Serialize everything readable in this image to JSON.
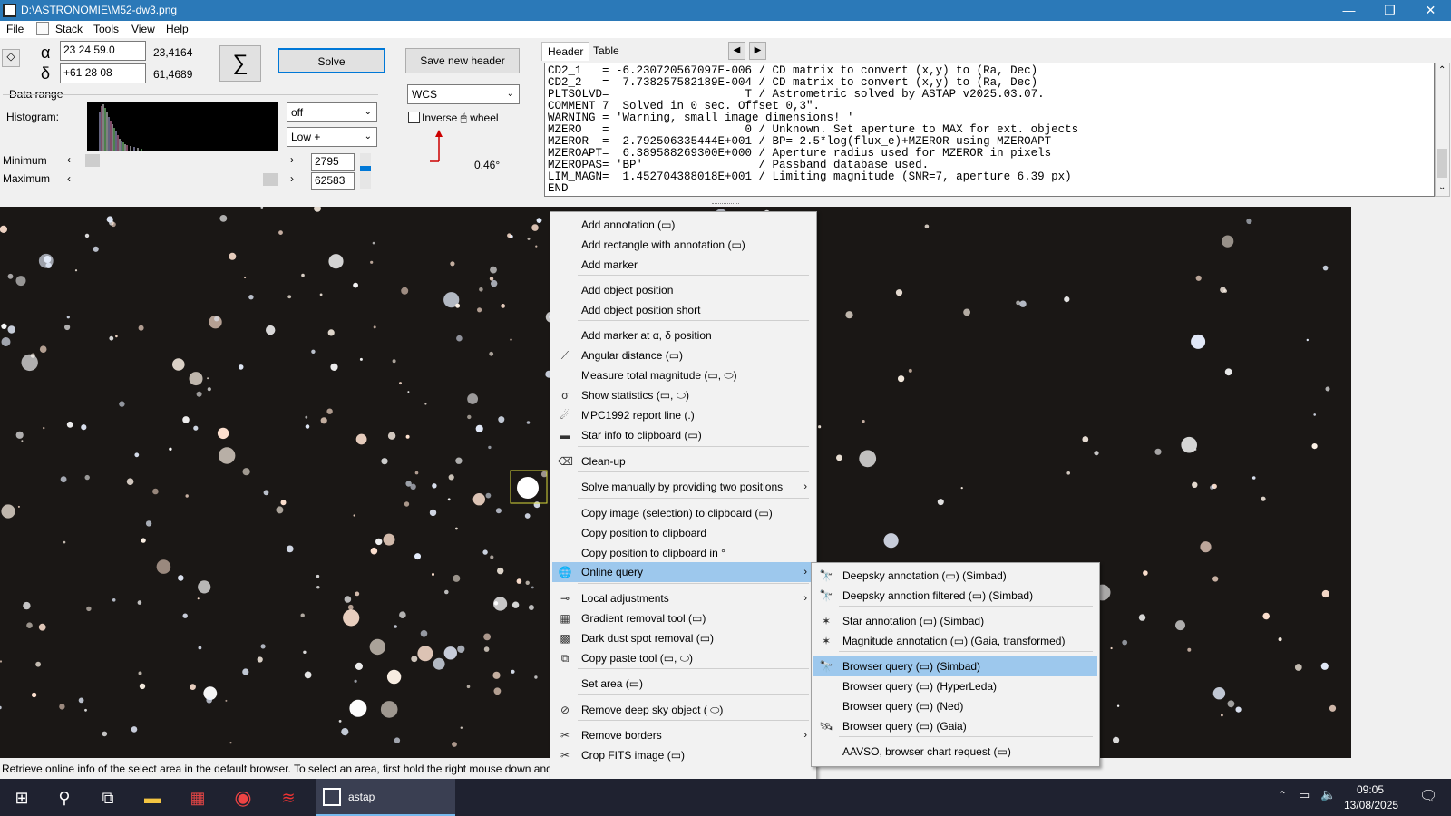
{
  "window": {
    "title": "D:\\ASTRONOMIE\\M52-dw3.png",
    "controls": [
      "—",
      "❐",
      "✕"
    ]
  },
  "menubar": [
    "File",
    "Stack",
    "Tools",
    "View",
    "Help"
  ],
  "coords": {
    "alpha_symbol": "α",
    "delta_symbol": "δ",
    "alpha_value": "23 24 59.0",
    "alpha_decimal": "23,4164",
    "delta_value": "+61 28 08",
    "delta_decimal": "61,4689"
  },
  "buttons": {
    "sigma": "∑",
    "solve": "Solve",
    "save_header": "Save new header"
  },
  "data_range": {
    "label": "Data range",
    "histogram_label": "Histogram:",
    "minimum_label": "Minimum",
    "maximum_label": "Maximum",
    "minimum_value": "2795",
    "maximum_value": "62583",
    "min_slider_pos": 0.04,
    "max_slider_pos": 0.96
  },
  "combos": {
    "stretch": "off",
    "range": "Low +",
    "wcs": "WCS"
  },
  "inverse_label": "Inverse 🖱 wheel",
  "angle_value": "0,46°",
  "header_panel": {
    "tabs": [
      "Header",
      "Table"
    ],
    "lines": [
      "CD2_1   = -6.230720567097E-006 / CD matrix to convert (x,y) to (Ra, Dec)",
      "CD2_2   =  7.738257582189E-004 / CD matrix to convert (x,y) to (Ra, Dec)",
      "PLTSOLVD=                    T / Astrometric solved by ASTAP v2025.03.07.",
      "COMMENT 7  Solved in 0 sec. Offset 0,3\".",
      "WARNING = 'Warning, small image dimensions! '",
      "MZERO   =                    0 / Unknown. Set aperture to MAX for ext. objects",
      "MZEROR  =  2.792506335444E+001 / BP=-2.5*log(flux_e)+MZEROR using MZEROAPT",
      "MZEROAPT=  6.389588269300E+000 / Aperture radius used for MZEROR in pixels",
      "MZEROPAS= 'BP'                 / Passband database used.",
      "LIM_MAGN=  1.452704388018E+001 / Limiting magnitude (SNR=7, aperture 6.39 px)",
      "END"
    ]
  },
  "status": "Retrieve online info of the select area in the default browser.  To select an area, first hold the right mouse down and",
  "context_menu": {
    "items": [
      {
        "label": "Add annotation (▭)",
        "icon": ""
      },
      {
        "label": "Add rectangle with annotation (▭)",
        "icon": ""
      },
      {
        "label": "Add marker",
        "icon": ""
      },
      {
        "label": "Add object position",
        "icon": ""
      },
      {
        "label": "Add object position short",
        "icon": ""
      },
      {
        "label": "Add marker at α, δ position",
        "icon": ""
      },
      {
        "label": "Angular distance (▭)",
        "icon": "⟋"
      },
      {
        "label": "Measure total magnitude (▭, ⬭)",
        "icon": ""
      },
      {
        "label": "Show statistics (▭, ⬭)",
        "icon": "σ"
      },
      {
        "label": "MPC1992 report line  (.)",
        "icon": "☄"
      },
      {
        "label": "Star info to clipboard (▭)",
        "icon": "▬"
      },
      {
        "label": "Clean-up",
        "icon": "⌫"
      },
      {
        "label": "Solve manually by providing two positions",
        "icon": ""
      },
      {
        "label": "Copy image (selection) to clipboard (▭)",
        "icon": ""
      },
      {
        "label": "Copy position to clipboard",
        "icon": ""
      },
      {
        "label": "Copy position to clipboard in °",
        "icon": ""
      },
      {
        "label": "Online query",
        "icon": "🌐"
      },
      {
        "label": "Local adjustments",
        "icon": "⊸"
      },
      {
        "label": "Gradient removal tool (▭)",
        "icon": "▦"
      },
      {
        "label": "Dark dust spot removal (▭)",
        "icon": "▩"
      },
      {
        "label": "Copy paste tool (▭, ⬭)",
        "icon": "⧉"
      },
      {
        "label": "Set area (▭)",
        "icon": ""
      },
      {
        "label": "Remove deep sky object ( ⬭)",
        "icon": "⊘"
      },
      {
        "label": "Remove borders",
        "icon": "✂"
      },
      {
        "label": "Crop FITS image (▭)",
        "icon": "✂"
      }
    ]
  },
  "submenu": {
    "items": [
      {
        "label": "Deepsky annotation (▭) (Simbad)",
        "icon": "🔭"
      },
      {
        "label": "Deepsky annotion filtered (▭) (Simbad)",
        "icon": "🔭"
      },
      {
        "label": "Star annotation (▭) (Simbad)",
        "icon": "✶"
      },
      {
        "label": "Magnitude annotation (▭) (Gaia, transformed)",
        "icon": "✶"
      },
      {
        "label": "Browser query (▭) (Simbad)",
        "icon": "🔭"
      },
      {
        "label": "Browser query (▭) (HyperLeda)",
        "icon": ""
      },
      {
        "label": "Browser query (▭) (Ned)",
        "icon": ""
      },
      {
        "label": "Browser query (▭) (Gaia)",
        "icon": "🛰"
      },
      {
        "label": "AAVSO, browser chart request (▭)",
        "icon": ""
      }
    ]
  },
  "taskbar": {
    "app_label": "astap",
    "time": "09:05",
    "date": "13/08/2025"
  },
  "colors": {
    "titlebar": "#2b79b8",
    "highlight": "#9dc8ed",
    "taskbar": "#1f2230",
    "sky": "#1a1715"
  }
}
